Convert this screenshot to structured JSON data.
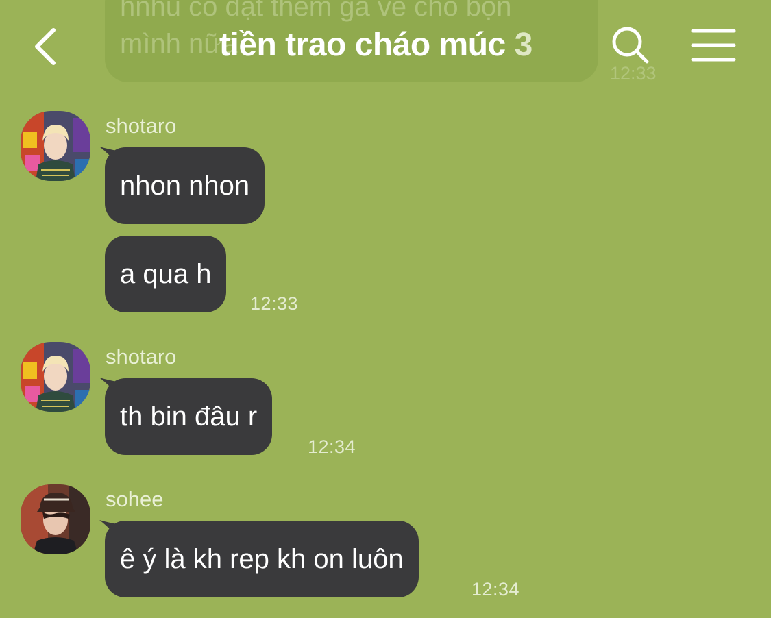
{
  "header": {
    "title": "tiền trao cháo múc",
    "member_count": "3",
    "back_icon": "chevron-left-icon",
    "search_icon": "search-icon",
    "menu_icon": "menu-icon"
  },
  "previous_message": {
    "line1": "hnhu có đặt thêm gà về cho bọn",
    "line2": "mình nữa",
    "time": "12:33"
  },
  "messages": [
    {
      "sender": "shotaro",
      "bubbles": [
        "nhon nhon",
        "a qua h"
      ],
      "time": "12:33"
    },
    {
      "sender": "shotaro",
      "bubbles": [
        "th bin đâu r"
      ],
      "time": "12:34"
    },
    {
      "sender": "sohee",
      "bubbles": [
        "ê ý là kh rep kh on luôn"
      ],
      "time": "12:34"
    }
  ],
  "colors": {
    "background": "#9bb357",
    "bubble": "#3a3a3c",
    "text": "#ffffff"
  }
}
